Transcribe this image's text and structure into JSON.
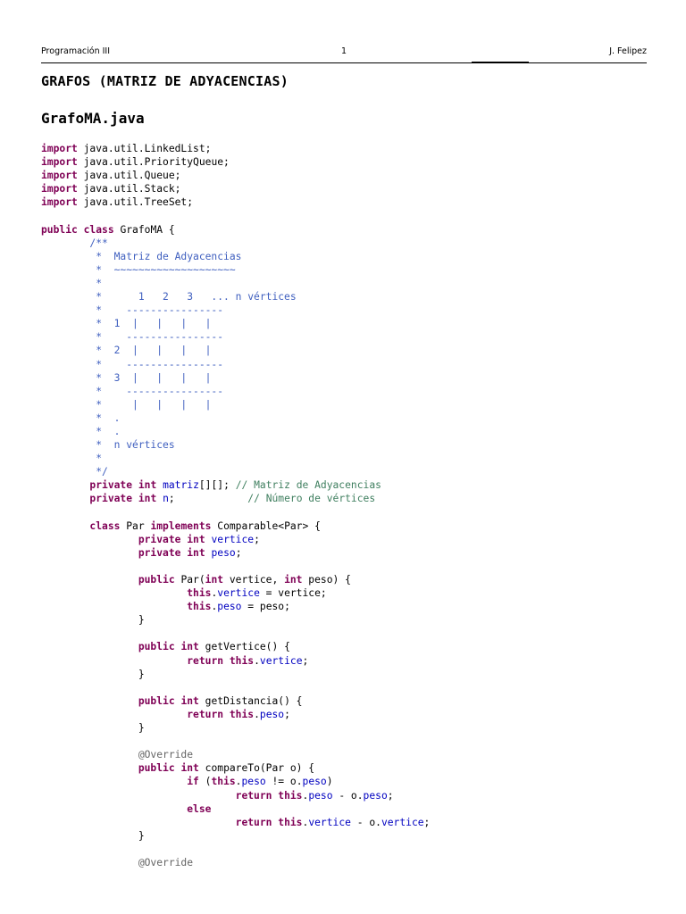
{
  "header": {
    "left": "Programación III",
    "page_number": "1",
    "right": "J. Felipez"
  },
  "doc_title": "GRAFOS (MATRIZ DE ADYACENCIAS)",
  "file_title": "GrafoMA.java",
  "colors": {
    "keyword": "#7f0055",
    "field": "#0000c0",
    "javadoc": "#3f5fbf",
    "line_comment": "#3f7f5f",
    "annotation": "#646464",
    "text": "#000000"
  },
  "code_lines": [
    [
      [
        "kw",
        "import"
      ],
      [
        "plain",
        " java.util.LinkedList;"
      ]
    ],
    [
      [
        "kw",
        "import"
      ],
      [
        "plain",
        " java.util.PriorityQueue;"
      ]
    ],
    [
      [
        "kw",
        "import"
      ],
      [
        "plain",
        " java.util.Queue;"
      ]
    ],
    [
      [
        "kw",
        "import"
      ],
      [
        "plain",
        " java.util.Stack;"
      ]
    ],
    [
      [
        "kw",
        "import"
      ],
      [
        "plain",
        " java.util.TreeSet;"
      ]
    ],
    [],
    [
      [
        "kw",
        "public"
      ],
      [
        "plain",
        " "
      ],
      [
        "kw",
        "class"
      ],
      [
        "plain",
        " GrafoMA {"
      ]
    ],
    [
      [
        "cm",
        "        /**"
      ]
    ],
    [
      [
        "cm",
        "         *  Matriz de Adyacencias"
      ]
    ],
    [
      [
        "cm",
        "         *  ~~~~~~~~~~~~~~~~~~~~"
      ]
    ],
    [
      [
        "cm",
        "         *"
      ]
    ],
    [
      [
        "cm",
        "         *      1   2   3   ... n vértices"
      ]
    ],
    [
      [
        "cm",
        "         *    ----------------"
      ]
    ],
    [
      [
        "cm",
        "         *  1  |   |   |   |"
      ]
    ],
    [
      [
        "cm",
        "         *    ----------------"
      ]
    ],
    [
      [
        "cm",
        "         *  2  |   |   |   |"
      ]
    ],
    [
      [
        "cm",
        "         *    ----------------"
      ]
    ],
    [
      [
        "cm",
        "         *  3  |   |   |   |"
      ]
    ],
    [
      [
        "cm",
        "         *    ----------------"
      ]
    ],
    [
      [
        "cm",
        "         *     |   |   |   |"
      ]
    ],
    [
      [
        "cm",
        "         *  ."
      ]
    ],
    [
      [
        "cm",
        "         *  ."
      ]
    ],
    [
      [
        "cm",
        "         *  n vértices"
      ]
    ],
    [
      [
        "cm",
        "         *"
      ]
    ],
    [
      [
        "cm",
        "         */"
      ]
    ],
    [
      [
        "plain",
        "        "
      ],
      [
        "kw",
        "private"
      ],
      [
        "plain",
        " "
      ],
      [
        "kw",
        "int"
      ],
      [
        "plain",
        " "
      ],
      [
        "field",
        "matriz"
      ],
      [
        "plain",
        "[][]; "
      ],
      [
        "lc",
        "// Matriz de Adyacencias"
      ]
    ],
    [
      [
        "plain",
        "        "
      ],
      [
        "kw",
        "private"
      ],
      [
        "plain",
        " "
      ],
      [
        "kw",
        "int"
      ],
      [
        "plain",
        " "
      ],
      [
        "field",
        "n"
      ],
      [
        "plain",
        ";            "
      ],
      [
        "lc",
        "// Número de vértices"
      ]
    ],
    [],
    [
      [
        "plain",
        "        "
      ],
      [
        "kw",
        "class"
      ],
      [
        "plain",
        " Par "
      ],
      [
        "kw",
        "implements"
      ],
      [
        "plain",
        " Comparable<Par> {"
      ]
    ],
    [
      [
        "plain",
        "                "
      ],
      [
        "kw",
        "private"
      ],
      [
        "plain",
        " "
      ],
      [
        "kw",
        "int"
      ],
      [
        "plain",
        " "
      ],
      [
        "field",
        "vertice"
      ],
      [
        "plain",
        ";"
      ]
    ],
    [
      [
        "plain",
        "                "
      ],
      [
        "kw",
        "private"
      ],
      [
        "plain",
        " "
      ],
      [
        "kw",
        "int"
      ],
      [
        "plain",
        " "
      ],
      [
        "field",
        "peso"
      ],
      [
        "plain",
        ";"
      ]
    ],
    [],
    [
      [
        "plain",
        "                "
      ],
      [
        "kw",
        "public"
      ],
      [
        "plain",
        " Par("
      ],
      [
        "kw",
        "int"
      ],
      [
        "plain",
        " vertice, "
      ],
      [
        "kw",
        "int"
      ],
      [
        "plain",
        " peso) {"
      ]
    ],
    [
      [
        "plain",
        "                        "
      ],
      [
        "kw",
        "this"
      ],
      [
        "plain",
        "."
      ],
      [
        "field",
        "vertice"
      ],
      [
        "plain",
        " = vertice;"
      ]
    ],
    [
      [
        "plain",
        "                        "
      ],
      [
        "kw",
        "this"
      ],
      [
        "plain",
        "."
      ],
      [
        "field",
        "peso"
      ],
      [
        "plain",
        " = peso;"
      ]
    ],
    [
      [
        "plain",
        "                }"
      ]
    ],
    [],
    [
      [
        "plain",
        "                "
      ],
      [
        "kw",
        "public"
      ],
      [
        "plain",
        " "
      ],
      [
        "kw",
        "int"
      ],
      [
        "plain",
        " getVertice() {"
      ]
    ],
    [
      [
        "plain",
        "                        "
      ],
      [
        "kw",
        "return"
      ],
      [
        "plain",
        " "
      ],
      [
        "kw",
        "this"
      ],
      [
        "plain",
        "."
      ],
      [
        "field",
        "vertice"
      ],
      [
        "plain",
        ";"
      ]
    ],
    [
      [
        "plain",
        "                }"
      ]
    ],
    [],
    [
      [
        "plain",
        "                "
      ],
      [
        "kw",
        "public"
      ],
      [
        "plain",
        " "
      ],
      [
        "kw",
        "int"
      ],
      [
        "plain",
        " getDistancia() {"
      ]
    ],
    [
      [
        "plain",
        "                        "
      ],
      [
        "kw",
        "return"
      ],
      [
        "plain",
        " "
      ],
      [
        "kw",
        "this"
      ],
      [
        "plain",
        "."
      ],
      [
        "field",
        "peso"
      ],
      [
        "plain",
        ";"
      ]
    ],
    [
      [
        "plain",
        "                }"
      ]
    ],
    [],
    [
      [
        "plain",
        "                "
      ],
      [
        "an",
        "@Override"
      ]
    ],
    [
      [
        "plain",
        "                "
      ],
      [
        "kw",
        "public"
      ],
      [
        "plain",
        " "
      ],
      [
        "kw",
        "int"
      ],
      [
        "plain",
        " compareTo(Par o) {"
      ]
    ],
    [
      [
        "plain",
        "                        "
      ],
      [
        "kw",
        "if"
      ],
      [
        "plain",
        " ("
      ],
      [
        "kw",
        "this"
      ],
      [
        "plain",
        "."
      ],
      [
        "field",
        "peso"
      ],
      [
        "plain",
        " != o."
      ],
      [
        "field",
        "peso"
      ],
      [
        "plain",
        ")"
      ]
    ],
    [
      [
        "plain",
        "                                "
      ],
      [
        "kw",
        "return"
      ],
      [
        "plain",
        " "
      ],
      [
        "kw",
        "this"
      ],
      [
        "plain",
        "."
      ],
      [
        "field",
        "peso"
      ],
      [
        "plain",
        " - o."
      ],
      [
        "field",
        "peso"
      ],
      [
        "plain",
        ";"
      ]
    ],
    [
      [
        "plain",
        "                        "
      ],
      [
        "kw",
        "else"
      ]
    ],
    [
      [
        "plain",
        "                                "
      ],
      [
        "kw",
        "return"
      ],
      [
        "plain",
        " "
      ],
      [
        "kw",
        "this"
      ],
      [
        "plain",
        "."
      ],
      [
        "field",
        "vertice"
      ],
      [
        "plain",
        " - o."
      ],
      [
        "field",
        "vertice"
      ],
      [
        "plain",
        ";"
      ]
    ],
    [
      [
        "plain",
        "                }"
      ]
    ],
    [],
    [
      [
        "plain",
        "                "
      ],
      [
        "an",
        "@Override"
      ]
    ]
  ]
}
